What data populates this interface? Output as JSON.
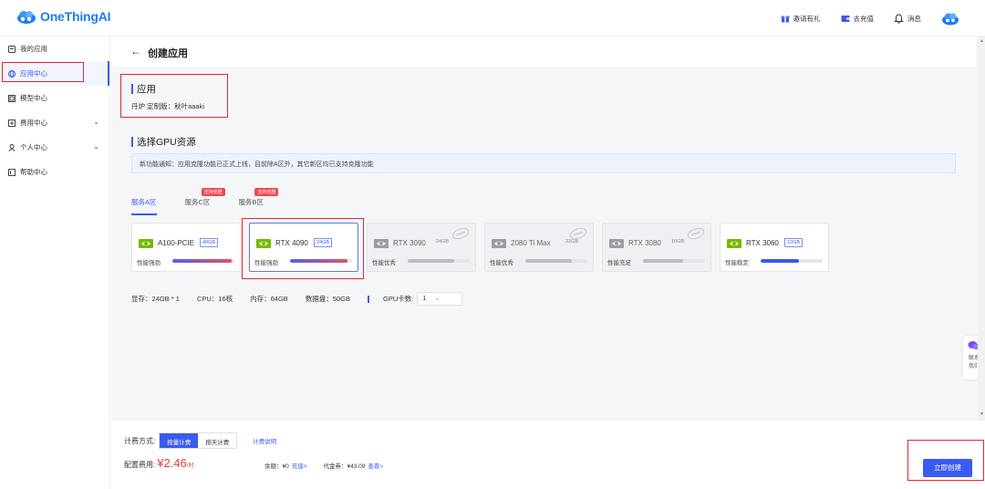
{
  "topbar": {
    "logo_text": "OneThingAI",
    "actions": [
      {
        "icon": "gift-icon",
        "label": "邀请有礼"
      },
      {
        "icon": "wallet-icon",
        "label": "去充值"
      },
      {
        "icon": "bell-icon",
        "label": "消息"
      }
    ]
  },
  "sidebar": {
    "items": [
      {
        "label": "我的应用",
        "icon": "app-icon",
        "active": false,
        "expandable": false
      },
      {
        "label": "应用中心",
        "icon": "globe-icon",
        "active": true,
        "expandable": false
      },
      {
        "label": "模型中心",
        "icon": "model-icon",
        "active": false,
        "expandable": false
      },
      {
        "label": "费用中心",
        "icon": "billing-icon",
        "active": false,
        "expandable": true
      },
      {
        "label": "个人中心",
        "icon": "user-icon",
        "active": false,
        "expandable": true
      },
      {
        "label": "帮助中心",
        "icon": "help-icon",
        "active": false,
        "expandable": false
      }
    ]
  },
  "page": {
    "back_icon": "←",
    "title": "创建应用"
  },
  "app_section": {
    "title": "应用",
    "subtitle": "丹炉 定制版：秋叶aaaki"
  },
  "gpu_section": {
    "title": "选择GPU资源",
    "notice": "新功能通知：应用克隆功能已正式上线，目前除A区外，其它新区均已支持克隆功能"
  },
  "tabs": [
    {
      "label": "服务A区",
      "active": true,
      "badge": ""
    },
    {
      "label": "服务C区",
      "active": false,
      "badge": "支持克隆"
    },
    {
      "label": "服务B区",
      "active": false,
      "badge": "支持克隆"
    }
  ],
  "gpu_cards": [
    {
      "name": "A100-PCIE",
      "memory": "40GB",
      "perf_label": "性能强劲",
      "level": 0.95,
      "bar_color": "gradient",
      "selected": false,
      "disabled": false
    },
    {
      "name": "RTX 4090",
      "memory": "24GB",
      "perf_label": "性能强劲",
      "level": 0.92,
      "bar_color": "gradient",
      "selected": true,
      "disabled": false
    },
    {
      "name": "RTX 3090",
      "memory": "24GB",
      "perf_label": "性能优秀",
      "level": 0.75,
      "bar_color": "gray",
      "selected": false,
      "disabled": true
    },
    {
      "name": "2080 Ti Max",
      "memory": "22GB",
      "perf_label": "性能优秀",
      "level": 0.75,
      "bar_color": "gray",
      "selected": false,
      "disabled": true
    },
    {
      "name": "RTX 3080",
      "memory": "10GB",
      "perf_label": "性能充足",
      "level": 0.65,
      "bar_color": "gray",
      "selected": false,
      "disabled": true
    },
    {
      "name": "RTX 3060",
      "memory": "12GB",
      "perf_label": "性能稳定",
      "level": 0.62,
      "bar_color": "blue",
      "selected": false,
      "disabled": false
    }
  ],
  "specs": {
    "vram": "显存：24GB * 1",
    "cpu": "CPU：16核",
    "ram": "内存：64GB",
    "disk": "数据盘：50GB",
    "gpu_count_label": "GPU卡数:",
    "gpu_count_value": "1"
  },
  "contact": {
    "label_1": "联系",
    "label_2": "我们"
  },
  "footer": {
    "billing_label": "计费方式:",
    "mode_on": "按量计费",
    "mode_off": "按天计费",
    "billing_help": "计费说明",
    "cost_label": "配置费用:",
    "price": "¥2.46",
    "price_unit": "/时",
    "balance_label": "余额：¥0",
    "recharge_link": "充值>",
    "voucher_label": "代金券：¥43.09",
    "voucher_link": "查看>",
    "create_button": "立即创建"
  },
  "colors": {
    "accent": "#3a5bef",
    "price": "#e83a3f",
    "highlight_box": "#e0282e",
    "nvidia_green": "#76b900"
  }
}
